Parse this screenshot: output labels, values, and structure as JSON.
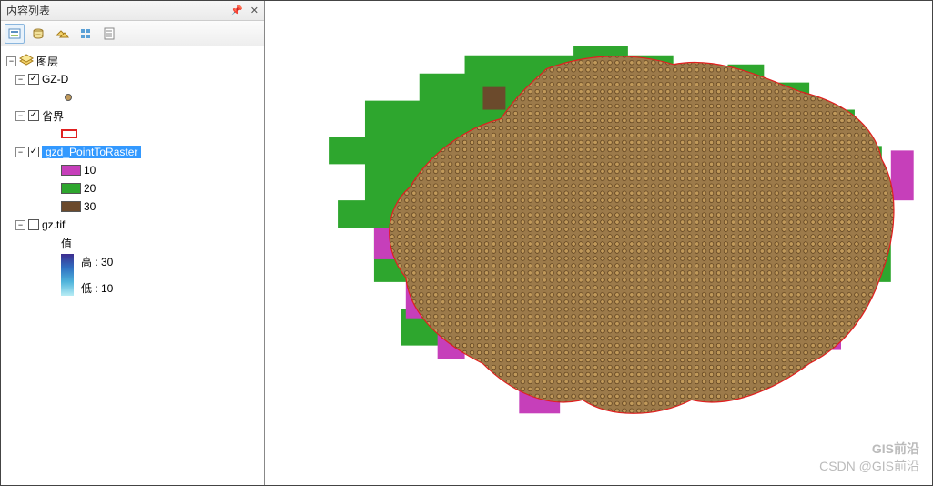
{
  "toc": {
    "title": "内容列表",
    "pin_icon": "pin-icon",
    "close_icon": "close-icon",
    "root_label": "图层",
    "layers": {
      "gzd": {
        "label": "GZ-D",
        "checked": true
      },
      "province": {
        "label": "省界",
        "checked": true
      },
      "p2r": {
        "label": "gzd_PointToRaster",
        "checked": true,
        "selected": true,
        "classes": {
          "c10": "10",
          "c20": "20",
          "c30": "30"
        },
        "colors": {
          "c10": "#c63fba",
          "c20": "#2ea62e",
          "c30": "#6b4a2c"
        }
      },
      "gztif": {
        "label": "gz.tif",
        "checked": false,
        "value_label": "值",
        "high_label": "高 : 30",
        "low_label": "低 : 10"
      }
    }
  },
  "watermark": {
    "line1": "GIS前沿",
    "line2": "CSDN @GIS前沿"
  }
}
